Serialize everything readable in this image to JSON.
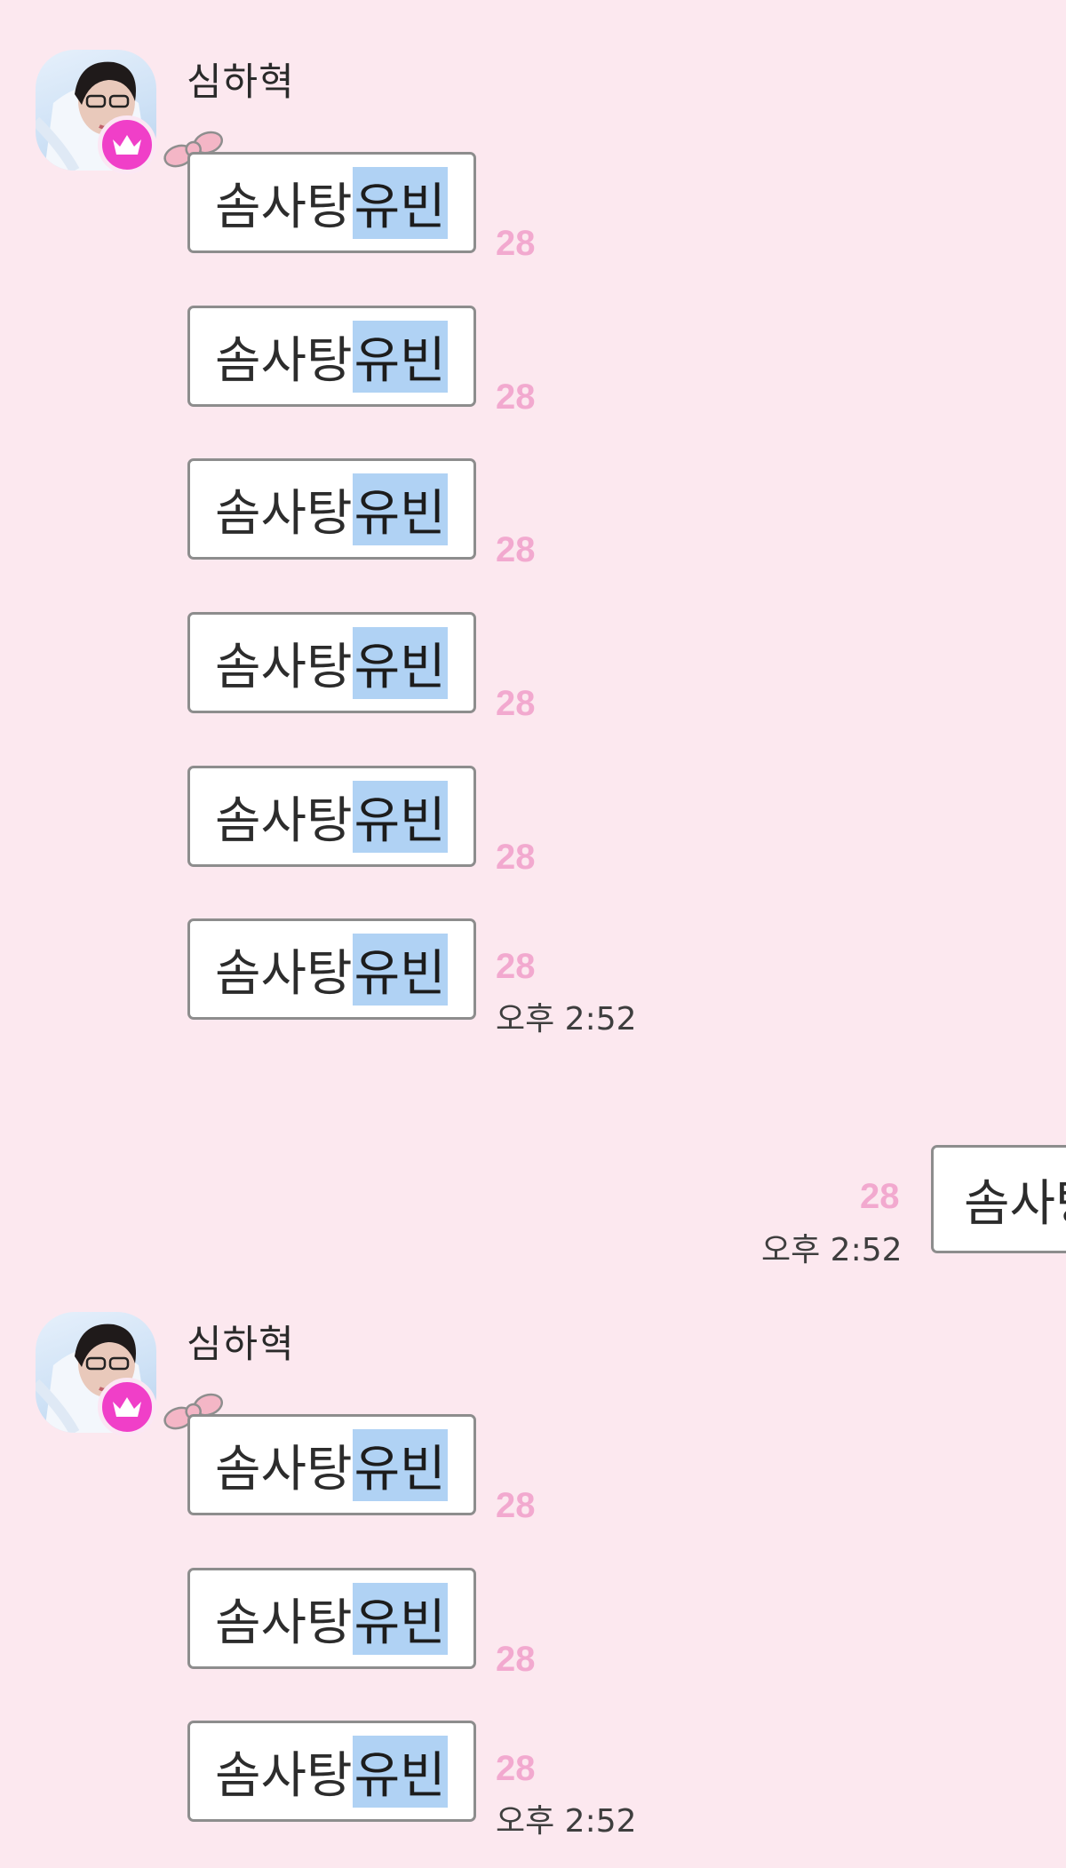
{
  "group_1": {
    "sender_name": "심하혁",
    "messages": [
      {
        "text_plain": "솜사탕",
        "text_highlight": "유빈",
        "unread": "28"
      },
      {
        "text_plain": "솜사탕",
        "text_highlight": "유빈",
        "unread": "28"
      },
      {
        "text_plain": "솜사탕",
        "text_highlight": "유빈",
        "unread": "28"
      },
      {
        "text_plain": "솜사탕",
        "text_highlight": "유빈",
        "unread": "28"
      },
      {
        "text_plain": "솜사탕",
        "text_highlight": "유빈",
        "unread": "28"
      },
      {
        "text_plain": "솜사탕",
        "text_highlight": "유빈",
        "unread": "28"
      }
    ],
    "time": "오후 2:52"
  },
  "my_message": {
    "text": "솜사탕",
    "unread": "28",
    "time": "오후 2:52"
  },
  "group_2": {
    "sender_name": "심하혁",
    "messages": [
      {
        "text_plain": "솜사탕",
        "text_highlight": "유빈",
        "unread": "28"
      },
      {
        "text_plain": "솜사탕",
        "text_highlight": "유빈",
        "unread": "28"
      },
      {
        "text_plain": "솜사탕",
        "text_highlight": "유빈",
        "unread": "28"
      }
    ],
    "time": "오후 2:52"
  },
  "colors": {
    "background": "#fce8ef",
    "unread_count": "#f2a9cf",
    "highlight": "#b0d2f4",
    "crown_badge": "#f03fc8",
    "bubble_border": "#8d8d8d"
  },
  "icons": [
    "profile-avatar",
    "crown-icon",
    "ribbon-bow-icon"
  ]
}
